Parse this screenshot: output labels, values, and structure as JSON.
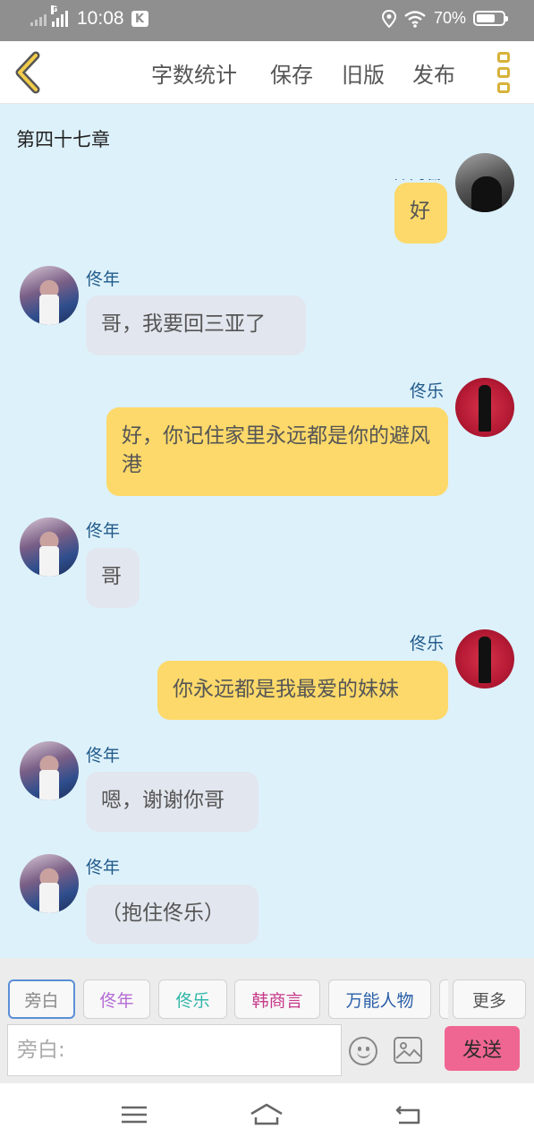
{
  "status_bar": {
    "network_badge": "G",
    "time": "10:08",
    "app_badge": "K",
    "battery_percent_label": "70%",
    "battery_level": 0.7,
    "icons": [
      "location-icon",
      "wifi-icon",
      "battery-icon"
    ]
  },
  "toolbar": {
    "back_icon": "chevron-left-icon",
    "word_count_label": "字数统计",
    "save_label": "保存",
    "old_version_label": "旧版",
    "publish_label": "发布",
    "more_icon": "more-vertical-icon"
  },
  "chapter_title": "第四十七章",
  "messages": [
    {
      "side": "right",
      "speaker": "韩商言",
      "text": "好",
      "partially_hidden_name": true
    },
    {
      "side": "left",
      "speaker": "佟年",
      "text": "哥，我要回三亚了"
    },
    {
      "side": "right",
      "speaker": "佟乐",
      "text": "好，你记住家里永远都是你的避风港"
    },
    {
      "side": "left",
      "speaker": "佟年",
      "text": "哥"
    },
    {
      "side": "right",
      "speaker": "佟乐",
      "text": "你永远都是我最爱的妹妹"
    },
    {
      "side": "left",
      "speaker": "佟年",
      "text": "嗯，谢谢你哥"
    },
    {
      "side": "left",
      "speaker": "佟年",
      "text": "（抱住佟乐）"
    }
  ],
  "role_tabs": [
    {
      "label": "旁白",
      "color": "#888888",
      "active": true
    },
    {
      "label": "佟年",
      "color": "#b36bd4",
      "active": false
    },
    {
      "label": "佟乐",
      "color": "#2fb6a8",
      "active": false
    },
    {
      "label": "韩商言",
      "color": "#c73a8a",
      "active": false
    },
    {
      "label": "万能人物",
      "color": "#2a5fa8",
      "active": false
    },
    {
      "label": "更多",
      "color": "#555555",
      "active": false
    }
  ],
  "composer": {
    "placeholder": "旁白:",
    "value": "",
    "emoji_icon": "emoji-icon",
    "image_icon": "image-icon",
    "send_label": "发送",
    "send_color": "#f06693"
  },
  "nav_bar": {
    "icons": [
      "menu-icon",
      "home-icon",
      "back-icon"
    ]
  },
  "colors": {
    "chat_background": "#ddf1fb",
    "left_bubble": "#e2e6ee",
    "right_bubble": "#fcd96a",
    "speaker_name": "#215a8a",
    "accent_more": "#d8b23a"
  }
}
